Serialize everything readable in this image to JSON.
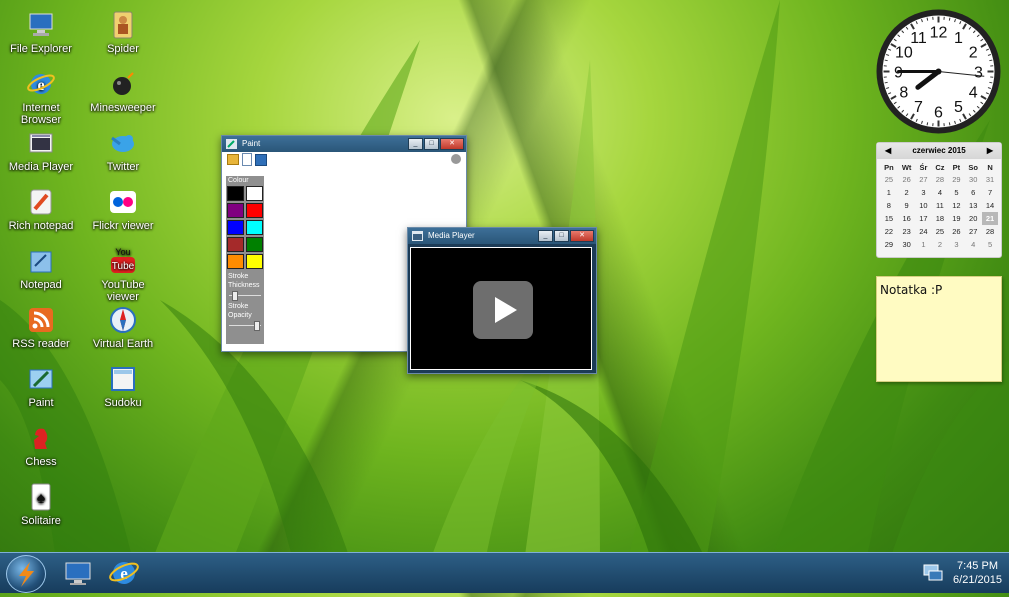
{
  "desktop": {
    "icons_left": [
      {
        "label": "File Explorer",
        "icon": "computer-icon"
      },
      {
        "label": "Internet Browser",
        "icon": "ie-icon"
      },
      {
        "label": "Media Player",
        "icon": "media-player-icon"
      },
      {
        "label": "Rich notepad",
        "icon": "rich-notepad-icon"
      },
      {
        "label": "Notepad",
        "icon": "notepad-icon"
      },
      {
        "label": "RSS reader",
        "icon": "rss-icon"
      },
      {
        "label": "Paint",
        "icon": "paint-icon"
      },
      {
        "label": "Chess",
        "icon": "chess-icon"
      },
      {
        "label": "Solitaire",
        "icon": "solitaire-icon"
      }
    ],
    "icons_right": [
      {
        "label": "Spider",
        "icon": "spider-icon"
      },
      {
        "label": "Minesweeper",
        "icon": "minesweeper-icon"
      },
      {
        "label": "Twitter",
        "icon": "twitter-icon"
      },
      {
        "label": "Flickr viewer",
        "icon": "flickr-icon"
      },
      {
        "label": "YouTube viewer",
        "icon": "youtube-icon"
      },
      {
        "label": "Virtual Earth",
        "icon": "compass-icon"
      },
      {
        "label": "Sudoku",
        "icon": "sudoku-icon"
      }
    ]
  },
  "paint": {
    "title": "Paint",
    "colour_label": "Colour",
    "stroke_thickness_label": "Stroke Thickness",
    "stroke_opacity_label": "Stroke Opacity",
    "swatches": [
      "#000000",
      "#ffffff",
      "#800080",
      "#ff0000",
      "#0000ff",
      "#00ffff",
      "#a52a2a",
      "#008000",
      "#ff8c00",
      "#ffff00"
    ]
  },
  "media_player": {
    "title": "Media Player",
    "play_icon": "play-icon"
  },
  "clock": {
    "numbers": [
      "12",
      "1",
      "2",
      "3",
      "4",
      "5",
      "6",
      "7",
      "8",
      "9",
      "10",
      "11"
    ],
    "hour": 7,
    "minute": 45,
    "second": 16
  },
  "calendar": {
    "month_label": "czerwiec 2015",
    "weekdays": [
      "Pn",
      "Wt",
      "Śr",
      "Cz",
      "Pt",
      "So",
      "N"
    ],
    "weeks": [
      [
        "25",
        "26",
        "27",
        "28",
        "29",
        "30",
        "31"
      ],
      [
        "1",
        "2",
        "3",
        "4",
        "5",
        "6",
        "7"
      ],
      [
        "8",
        "9",
        "10",
        "11",
        "12",
        "13",
        "14"
      ],
      [
        "15",
        "16",
        "17",
        "18",
        "19",
        "20",
        "21"
      ],
      [
        "22",
        "23",
        "24",
        "25",
        "26",
        "27",
        "28"
      ],
      [
        "29",
        "30",
        "1",
        "2",
        "3",
        "4",
        "5"
      ]
    ],
    "selected": "21"
  },
  "note": {
    "text": "Notatka :P"
  },
  "taskbar": {
    "time": "7:45 PM",
    "date": "6/21/2015"
  }
}
